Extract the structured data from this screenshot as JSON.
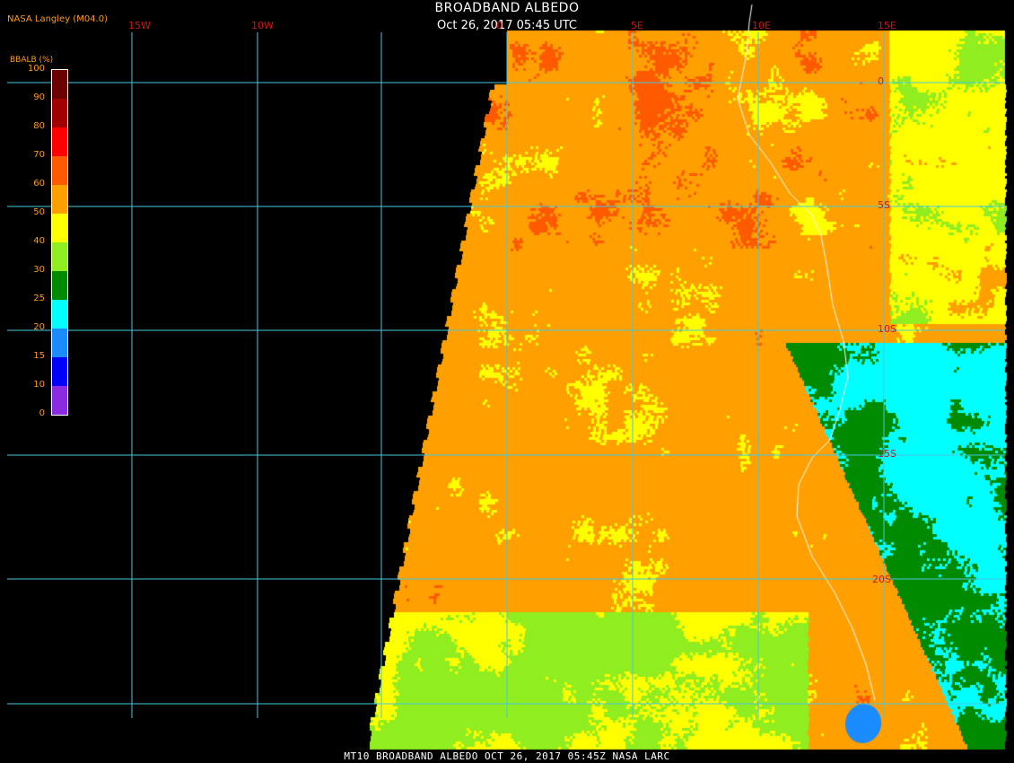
{
  "header": {
    "title": "BROADBAND ALBEDO",
    "timestamp": "Oct 26, 2017 05:45 UTC",
    "organization": "NASA Langley (M04.0)"
  },
  "footer": {
    "caption": "MT10  BROADBAND ALBEDO  OCT 26, 2017 05:45Z  NASA LARC"
  },
  "colorbar": {
    "title": "BBALB (%)",
    "bins": [
      {
        "label": "100",
        "color": "#6a0000"
      },
      {
        "label": "90",
        "color": "#a00000"
      },
      {
        "label": "80",
        "color": "#ff0000"
      },
      {
        "label": "70",
        "color": "#ff5a00"
      },
      {
        "label": "60",
        "color": "#ffa000"
      },
      {
        "label": "50",
        "color": "#ffff00"
      },
      {
        "label": "40",
        "color": "#90ee20"
      },
      {
        "label": "30",
        "color": "#008a00"
      },
      {
        "label": "25",
        "color": "#00ffff"
      },
      {
        "label": "20",
        "color": "#1a8cff"
      },
      {
        "label": "15",
        "color": "#0000ff"
      },
      {
        "label": "10",
        "color": "#8a2be2"
      }
    ],
    "bottom_label": "0"
  },
  "map": {
    "grid_color": "#46c8dc",
    "no_data_color": "#000000",
    "longitude_labels": [
      "15W",
      "10W",
      "0",
      "5E",
      "10E",
      "15E"
    ],
    "latitude_labels": [
      "0",
      "5S",
      "10S",
      "15S",
      "20S"
    ]
  }
}
